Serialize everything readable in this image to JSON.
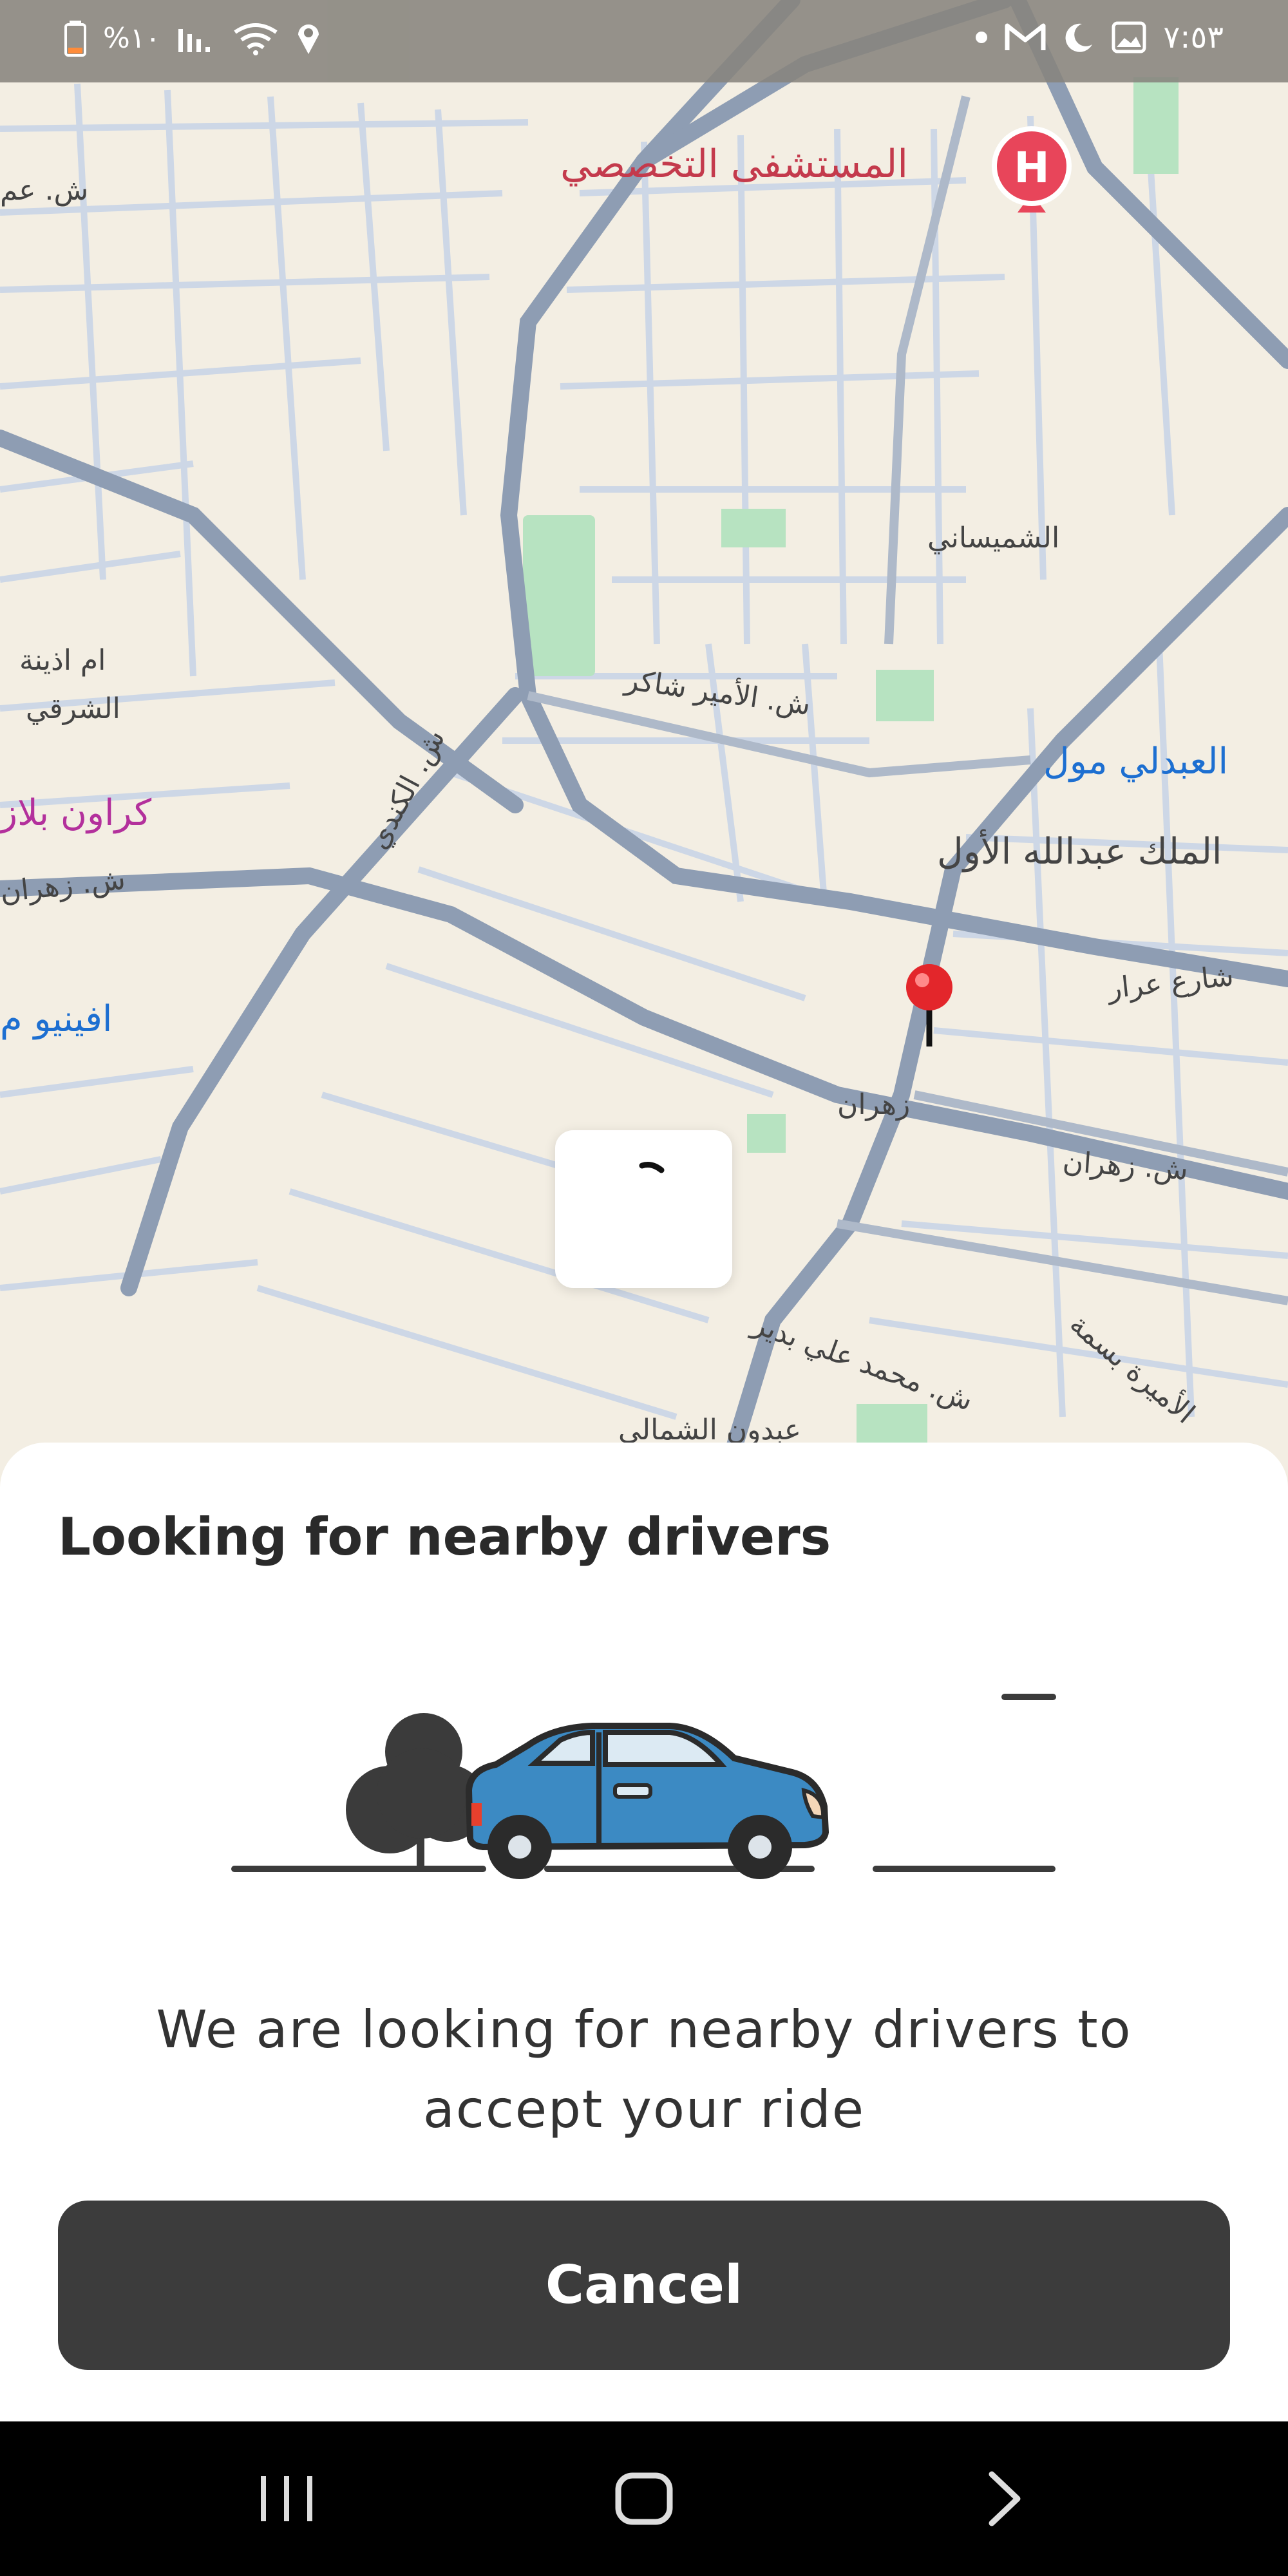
{
  "status_bar": {
    "battery_text": "%١٠",
    "time": "٧:٥٣"
  },
  "map": {
    "labels": {
      "hospital": "المستشفى التخصصي",
      "street_top_left": "ش. عم",
      "shmeisani": "الشميساني",
      "umm_uthaina_1": "ام اذينة",
      "umm_uthaina_2": "الشرقي",
      "prince_shaker": "ش. الأمير شاكر",
      "kindi": "ش. الكندي",
      "abdali_mall": "العبدلي مول",
      "king_abdullah": "الملك عبدالله الأول",
      "crowne_plaza": "كراون بلاز",
      "zahran_left": "ش. زهران",
      "arar": "شارع عرار",
      "avenue_mall": "افينيو م",
      "zahran_center": "زهران",
      "zahran_right": "ش. زهران",
      "mohammad_ali_bdeir": "ش. محمد علي بدير",
      "princess_basma": "الأميرة بسمة",
      "abdoun": "عبدون الشمالي"
    },
    "colors": {
      "land": "#f3eee3",
      "major_road": "#8e9db3",
      "minor_road": "#c9d3e2",
      "park": "#b7e3c1",
      "pin": "#e3262b"
    }
  },
  "sheet": {
    "title": "Looking for nearby drivers",
    "message": "We are looking for nearby drivers to accept your ride",
    "cancel_label": "Cancel"
  },
  "icons": {
    "battery": "battery-icon",
    "signal": "signal-icon",
    "wifi": "wifi-icon",
    "location": "location-icon",
    "dot": "notification-dot-icon",
    "gmail": "gmail-icon",
    "moon": "moon-icon",
    "gallery": "gallery-icon",
    "hospital_marker": "hospital-marker-icon",
    "map_pin": "map-pin-icon",
    "car": "car-illustration",
    "tree": "tree-icon",
    "recent_apps": "recent-apps-icon",
    "home": "home-icon",
    "back": "back-icon"
  }
}
